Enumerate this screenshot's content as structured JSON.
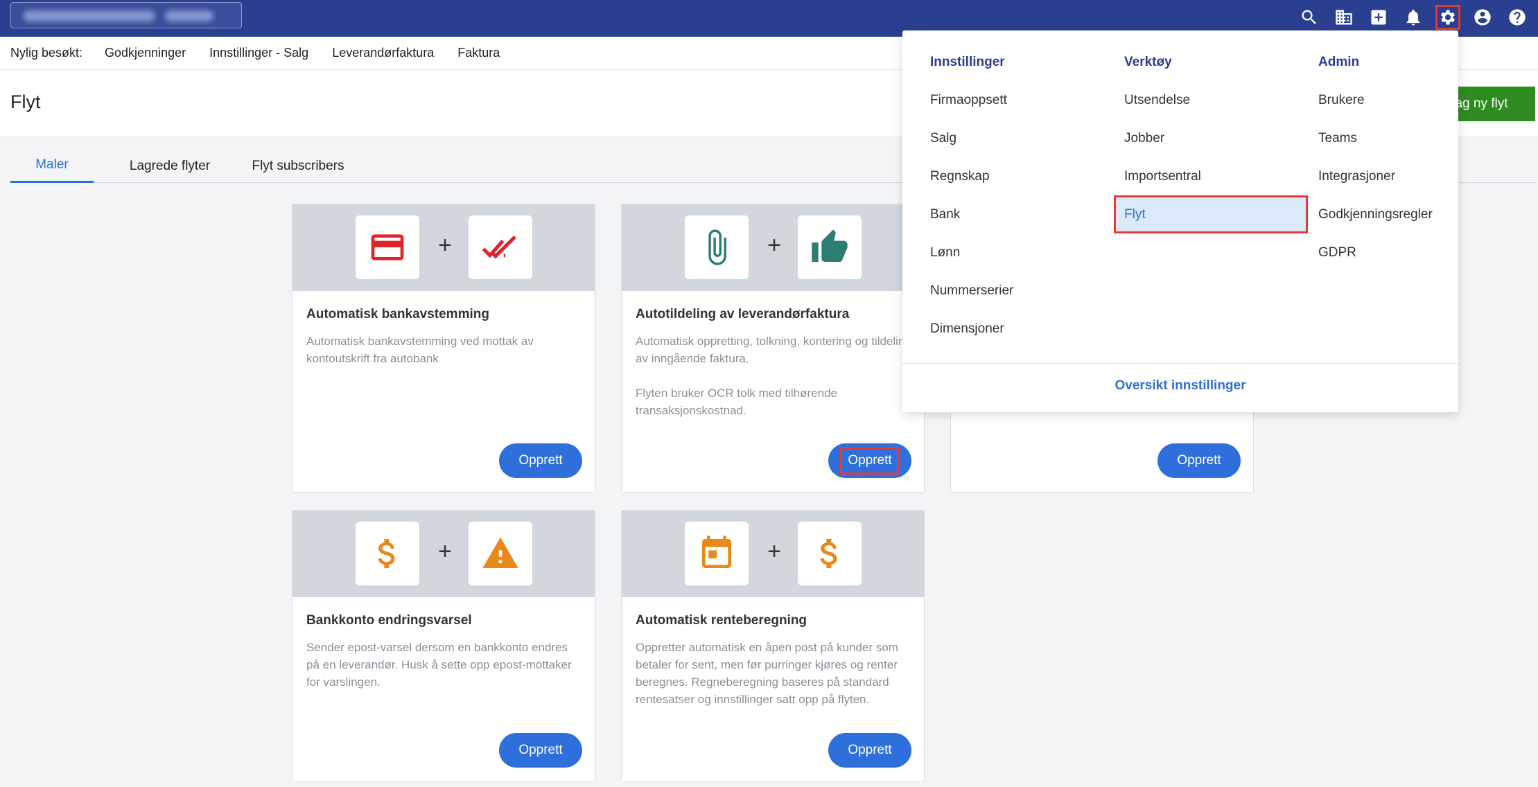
{
  "topbar": {
    "icons": [
      "search-icon",
      "building-icon",
      "add-box-icon",
      "bell-icon",
      "gear-icon",
      "account-icon",
      "help-icon"
    ],
    "active_icon": "gear-icon"
  },
  "recent": {
    "label": "Nylig besøkt:",
    "items": [
      "Godkjenninger",
      "Innstillinger - Salg",
      "Leverandørfaktura",
      "Faktura"
    ]
  },
  "page": {
    "title": "Flyt",
    "new_button": "ag ny flyt"
  },
  "tabs": [
    {
      "label": "Maler",
      "active": true
    },
    {
      "label": "Lagrede flyter",
      "active": false
    },
    {
      "label": "Flyt subscribers",
      "active": false
    }
  ],
  "cards": [
    {
      "title": "Automatisk bankavstemming",
      "description": "Automatisk bankavstemming ved mottak av kontoutskrift fra autobank",
      "button": "Opprett",
      "icons": [
        "credit-card-icon",
        "double-check-icon"
      ],
      "colors": {
        "icon": "#e0262b"
      }
    },
    {
      "title": "Autotildeling av leverandørfaktura",
      "description": "Automatisk oppretting, tolkning, kontering og tildeling av inngående faktura.\n\nFlyten bruker OCR tolk med tilhørende transaksjonskostnad.",
      "button": "Opprett",
      "icons": [
        "paperclip-icon",
        "thumbs-up-icon"
      ],
      "colors": {
        "icon": "#2e7d73"
      }
    },
    {
      "title": "",
      "description": "",
      "button": "Opprett",
      "icons": []
    },
    {
      "title": "Bankkonto endringsvarsel",
      "description": "Sender epost-varsel dersom en bankkonto endres på en leverandør. Husk å sette opp epost-mottaker for varslingen.",
      "button": "Opprett",
      "icons": [
        "dollar-icon",
        "warning-icon"
      ],
      "colors": {
        "icon": "#e8891a"
      }
    },
    {
      "title": "Automatisk renteberegning",
      "description": "Oppretter automatisk en åpen post på kunder som betaler for sent, men før purringer kjøres og renter beregnes. Regneberegning baseres på standard rentesatser og innstillinger satt opp på flyten.",
      "button": "Opprett",
      "icons": [
        "calendar-icon",
        "dollar-icon"
      ],
      "colors": {
        "icon": "#e8891a"
      }
    }
  ],
  "menu": {
    "columns": [
      {
        "heading": "Innstillinger",
        "items": [
          "Firmaoppsett",
          "Salg",
          "Regnskap",
          "Bank",
          "Lønn",
          "Nummerserier",
          "Dimensjoner"
        ]
      },
      {
        "heading": "Verktøy",
        "items": [
          "Utsendelse",
          "Jobber",
          "Importsentral",
          "Flyt"
        ]
      },
      {
        "heading": "Admin",
        "items": [
          "Brukere",
          "Teams",
          "Integrasjoner",
          "Godkjenningsregler",
          "GDPR"
        ]
      }
    ],
    "selected": "Flyt",
    "footer": "Oversikt innstillinger"
  },
  "colors": {
    "topbar": "#2a3f8f",
    "primary": "#2f6fdb",
    "green": "#2e8b1f",
    "highlight_border": "#e53935"
  }
}
